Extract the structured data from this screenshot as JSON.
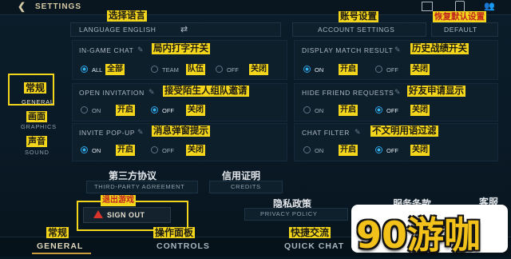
{
  "header": {
    "back_glyph": "❮",
    "title": "SETTINGS"
  },
  "top_ann": {
    "language": "选择语言",
    "account": "账号设置",
    "default": "恢复默认设置"
  },
  "top_row": {
    "language": "LANGUAGE ENGLISH",
    "swap": "⇄",
    "account": "ACCOUNT SETTINGS",
    "default": "DEFAULT"
  },
  "sidebar": [
    {
      "cn": "常规",
      "en": "GENERAL"
    },
    {
      "cn": "画面",
      "en": "GRAPHICS"
    },
    {
      "cn": "声音",
      "en": "SOUND"
    }
  ],
  "sections": {
    "ingame_chat": {
      "label": "IN-GAME CHAT",
      "ann": "局内打字开关",
      "opts": [
        "ALL",
        "TEAM",
        "OFF"
      ],
      "anns": [
        "全部",
        "队伍",
        "关闭"
      ]
    },
    "display_match": {
      "label": "DISPLAY MATCH RESULT",
      "ann": "历史战绩开关",
      "opts": [
        "ON",
        "OFF"
      ],
      "anns": [
        "开启",
        "关闭"
      ]
    },
    "open_invitation": {
      "label": "OPEN INVITATION",
      "ann": "接受陌生人组队邀请",
      "opts": [
        "ON",
        "OFF"
      ],
      "anns": [
        "开启",
        "关闭"
      ]
    },
    "hide_friend": {
      "label": "HIDE FRIEND REQUESTS",
      "ann": "好友申请显示",
      "opts": [
        "ON",
        "OFF"
      ],
      "anns": [
        "开启",
        "关闭"
      ]
    },
    "invite_popup": {
      "label": "INVITE POP-UP",
      "ann": "消息弹窗提示",
      "opts": [
        "ON",
        "OFF"
      ],
      "anns": [
        "开启",
        "关闭"
      ]
    },
    "chat_filter": {
      "label": "CHAT FILTER",
      "ann": "不文明用语过滤",
      "opts": [
        "ON",
        "OFF"
      ],
      "anns": [
        "开启",
        "关闭"
      ]
    }
  },
  "links": {
    "third_party_cn": "第三方协议",
    "third_party_en": "THIRD-PARTY AGREEMENT",
    "credits_cn": "信用证明",
    "credits_en": "CREDITS",
    "privacy_cn": "隐私政策",
    "privacy_en": "PRIVACY POLICY",
    "terms_cn": "服务条款",
    "support_cn": "客服"
  },
  "sign_out": {
    "ann": "退出游戏",
    "label": "SIGN OUT"
  },
  "bottom_tabs": [
    {
      "cn": "常规",
      "en": "GENERAL"
    },
    {
      "cn": "操作面板",
      "en": "CONTROLS"
    },
    {
      "cn": "快捷交流",
      "en": "QUICK CHAT"
    }
  ],
  "watermark": "90游咖",
  "colors": {
    "accent_blue": "#2aa3e6",
    "annotation_yellow": "#f3d51c",
    "gold": "#c89b3c"
  }
}
